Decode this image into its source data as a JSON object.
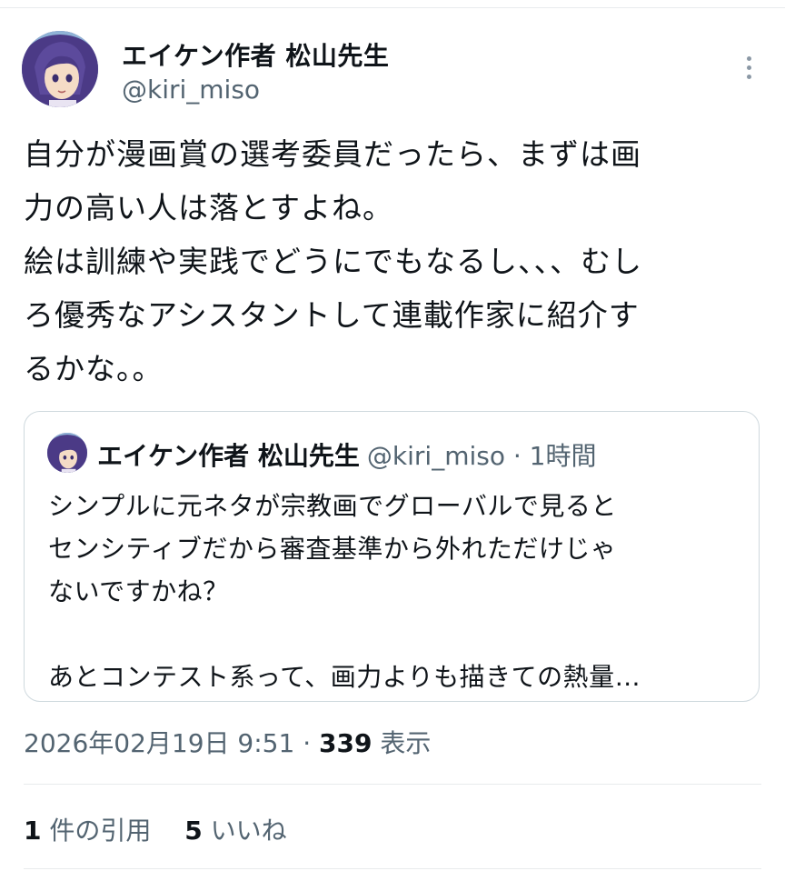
{
  "author": {
    "name": "エイケン作者 松山先生",
    "handle": "@kiri_miso"
  },
  "tweet": {
    "lines": [
      "自分が漫画賞の選考委員だったら、まずは画",
      "力の高い人は落とすよね。",
      "絵は訓練や実践でどうにでもなるし、、、むし",
      "ろ優秀なアシスタントして連載作家に紹介す",
      "るかな。。"
    ]
  },
  "quote": {
    "name": "エイケン作者 松山先生",
    "meta": "@kiri_miso · 1時間",
    "lines": [
      "シンプルに元ネタが宗教画でグローバルで見ると",
      "センシティブだから審査基準から外れただけじゃ",
      "ないですかね？",
      "",
      "あとコンテスト系って、画力よりも描きての熱量…"
    ]
  },
  "timestamp": {
    "datetime": "2026年02月19日 9:51",
    "separator": " · ",
    "views_count": "339",
    "views_label": " 表示"
  },
  "stats": {
    "quotes_count": "1",
    "quotes_label": " 件の引用",
    "likes_count": "5",
    "likes_label": " いいね"
  },
  "icons": {
    "more": "more-vertical-icon",
    "avatar": "avatar-image"
  }
}
